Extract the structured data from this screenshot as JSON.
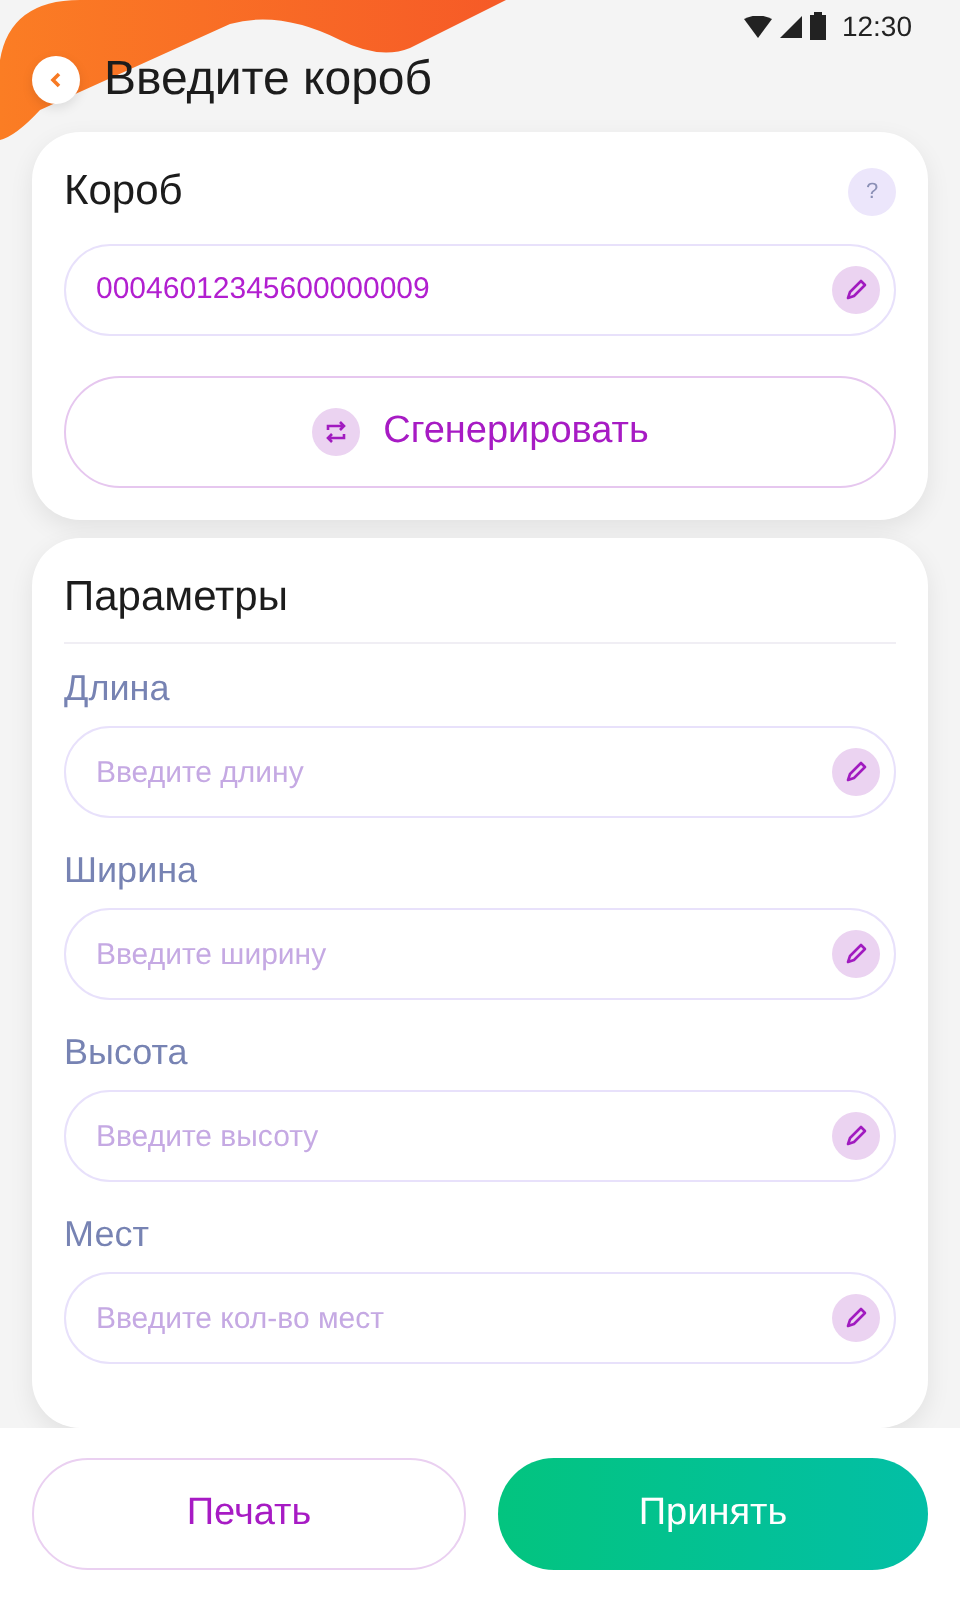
{
  "status_bar": {
    "time": "12:30"
  },
  "header": {
    "title": "Введите короб"
  },
  "box_card": {
    "title": "Короб",
    "help": "?",
    "value": "00046012345600000009",
    "generate_label": "Сгенерировать"
  },
  "params_card": {
    "title": "Параметры",
    "fields": [
      {
        "label": "Длина",
        "placeholder": "Введите длину"
      },
      {
        "label": "Ширина",
        "placeholder": "Введите ширину"
      },
      {
        "label": "Высота",
        "placeholder": "Введите высоту"
      },
      {
        "label": "Мест",
        "placeholder": "Введите кол-во мест"
      }
    ]
  },
  "buttons": [
    {
      "label": "Печать",
      "kind": "secondary"
    },
    {
      "label": "Принять",
      "kind": "primary"
    }
  ]
}
